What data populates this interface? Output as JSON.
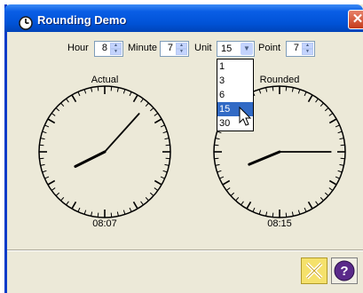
{
  "window": {
    "title": "Rounding Demo",
    "close_glyph": "✕"
  },
  "controls": {
    "hour": {
      "label": "Hour",
      "value": "8"
    },
    "minute": {
      "label": "Minute",
      "value": "7"
    },
    "unit": {
      "label": "Unit",
      "value": "15",
      "options": [
        "1",
        "3",
        "6",
        "15",
        "30"
      ],
      "selected_index": 3
    },
    "point": {
      "label": "Point",
      "value": "7"
    }
  },
  "clocks": {
    "actual": {
      "label": "Actual",
      "time": "08:07",
      "hour": 8,
      "minute": 7
    },
    "rounded": {
      "label": "Rounded",
      "time": "08:15",
      "hour": 8,
      "minute": 15
    }
  },
  "buttons": {
    "ok_icon": "close-yellow-icon",
    "help_icon": "help-icon"
  },
  "colors": {
    "titlebar": "#0a5ee6",
    "panel": "#ece9d8",
    "selection": "#316ac5",
    "ok_button": "#f5e16b",
    "help_button": "#5a2a8a"
  }
}
